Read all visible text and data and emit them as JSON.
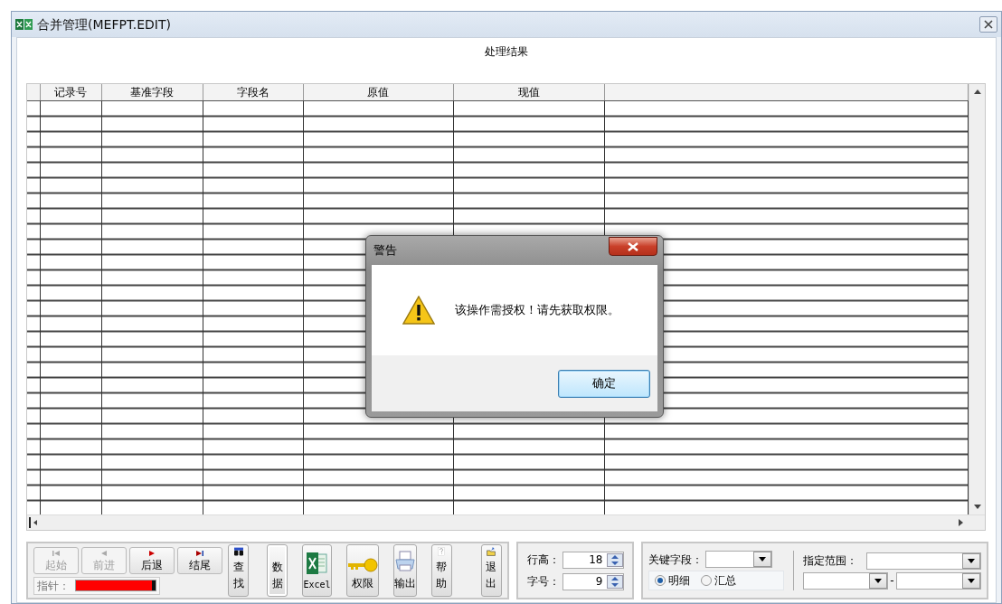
{
  "window": {
    "title": "合并管理(MEFPT.EDIT)"
  },
  "caption": "处理结果",
  "table": {
    "columns": [
      "记录号",
      "基准字段",
      "字段名",
      "原值",
      "现值"
    ]
  },
  "nav_buttons": [
    {
      "label": "起始",
      "kind": "first",
      "disabled": true
    },
    {
      "label": "前进",
      "kind": "prev",
      "disabled": true
    },
    {
      "label": "后退",
      "kind": "next",
      "disabled": false
    },
    {
      "label": "结尾",
      "kind": "last",
      "disabled": false
    }
  ],
  "pointer": {
    "label": "指针：",
    "level": 0.96
  },
  "tool_buttons": [
    {
      "label": "查找",
      "kind": "find"
    },
    {
      "label": "数据",
      "kind": "plain"
    },
    {
      "label": "Excel",
      "kind": "excel"
    },
    {
      "label": "权限",
      "kind": "key"
    },
    {
      "label": "输出",
      "kind": "printer"
    },
    {
      "label": "帮助",
      "kind": "help"
    },
    {
      "label": "退出",
      "kind": "exit"
    }
  ],
  "spinners": [
    {
      "label": "行高：",
      "value": "18"
    },
    {
      "label": "字号：",
      "value": "9"
    }
  ],
  "key_field": {
    "label": "关键字段："
  },
  "radios": [
    {
      "label": "明细",
      "selected": true
    },
    {
      "label": "汇总",
      "selected": false
    }
  ],
  "range": {
    "label": "指定范围：",
    "separator": "-"
  },
  "dialog": {
    "title": "警告",
    "message": "该操作需授权！请先获取权限。",
    "button": "确定"
  }
}
